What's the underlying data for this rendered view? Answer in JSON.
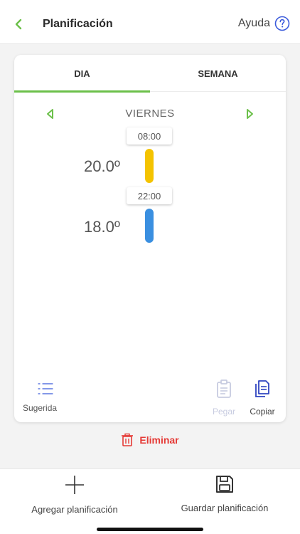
{
  "header": {
    "title": "Planificación",
    "help_label": "Ayuda"
  },
  "tabs": [
    {
      "label": "DIA",
      "active": true
    },
    {
      "label": "SEMANA",
      "active": false
    }
  ],
  "day": {
    "label": "VIERNES"
  },
  "schedule": [
    {
      "time": "08:00",
      "temperature": "20.0º",
      "color": "#f4c300"
    },
    {
      "time": "22:00",
      "temperature": "18.0º",
      "color": "#3a8fe0"
    }
  ],
  "actions": {
    "suggested_label": "Sugerida",
    "paste_label": "Pegar",
    "copy_label": "Copiar",
    "delete_label": "Eliminar"
  },
  "bottom": {
    "add_label": "Agregar planificación",
    "save_label": "Guardar planificación"
  },
  "colors": {
    "accent_green": "#6cc04a",
    "delete_red": "#e53935",
    "help_blue": "#3b5bdb",
    "copy_blue": "#2f44c0"
  }
}
